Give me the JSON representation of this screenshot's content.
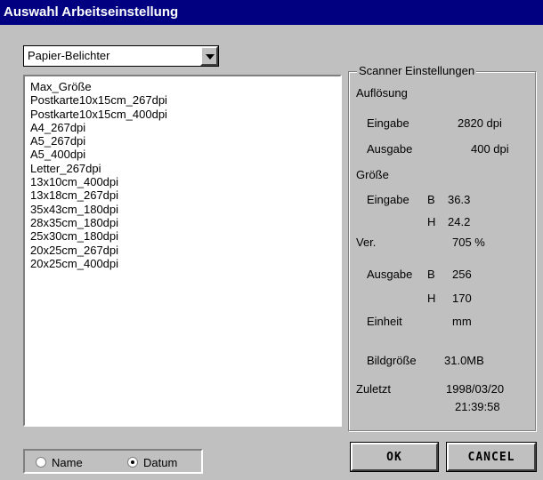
{
  "window": {
    "title": "Auswahl Arbeitseinstellung"
  },
  "combo": {
    "value": "Papier-Belichter"
  },
  "list": {
    "items": [
      "Max_Größe",
      "Postkarte10x15cm_267dpi",
      "Postkarte10x15cm_400dpi",
      "A4_267dpi",
      "A5_267dpi",
      "A5_400dpi",
      "Letter_267dpi",
      "13x10cm_400dpi",
      "13x18cm_267dpi",
      "35x43cm_180dpi",
      "28x35cm_180dpi",
      "25x30cm_180dpi",
      "20x25cm_267dpi",
      "20x25cm_400dpi"
    ]
  },
  "scanner": {
    "legend": "Scanner Einstellungen",
    "resolution_label": "Auflösung",
    "input_label": "Eingabe",
    "input_value": "2820 dpi",
    "output_label": "Ausgabe",
    "output_value": "400 dpi",
    "size_label": "Größe",
    "size_input_label": "Eingabe",
    "b_label": "B",
    "size_input_b": "36.3",
    "h_label": "H",
    "size_input_h": "24.2",
    "ver_label": "Ver.",
    "ver_value": "705 %",
    "size_output_label": "Ausgabe",
    "size_output_b": "256",
    "size_output_h": "170",
    "unit_label": "Einheit",
    "unit_value": "mm",
    "image_size_label": "Bildgröße",
    "image_size_value": "31.0MB",
    "last_label": "Zuletzt",
    "last_date": "1998/03/20",
    "last_time": "21:39:58"
  },
  "sort": {
    "name_label": "Name",
    "date_label": "Datum",
    "selected": "date"
  },
  "buttons": {
    "ok": "OK",
    "cancel": "CANCEL"
  }
}
